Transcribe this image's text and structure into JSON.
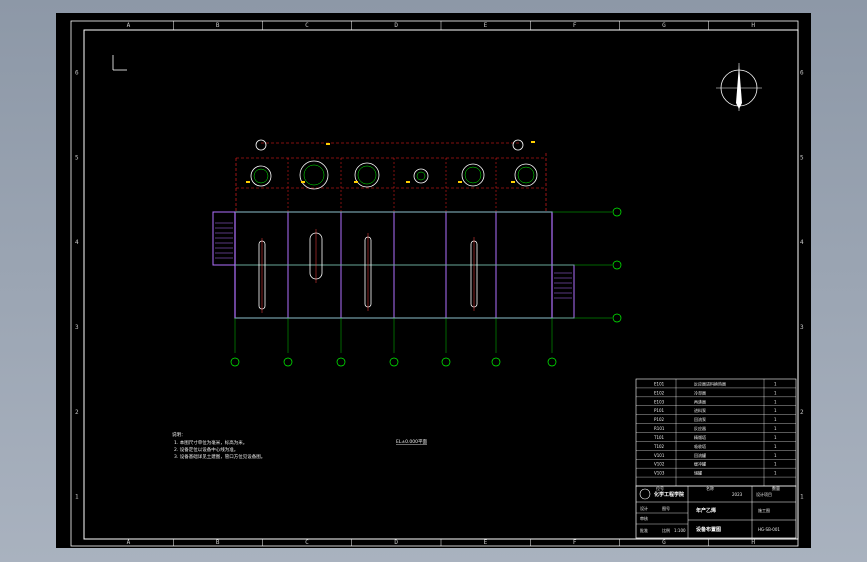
{
  "columns": [
    "A",
    "B",
    "C",
    "D",
    "E",
    "F",
    "G",
    "H"
  ],
  "rows": [
    "6",
    "5",
    "4",
    "3",
    "2",
    "1"
  ],
  "plan_title": "EL±0.000平面",
  "notes": {
    "heading": "说明：",
    "lines": [
      "1. 本图尺寸单位为毫米，标高为米。",
      "2. 设备定位以设备中心线为准。",
      "3. 设备基础详见土建图，管口方位见设备图。"
    ]
  },
  "equipment_list": [
    {
      "tag": "E101",
      "name": "反应器进料换热器",
      "qty": "1"
    },
    {
      "tag": "E102",
      "name": "冷却器",
      "qty": "1"
    },
    {
      "tag": "E103",
      "name": "再沸器",
      "qty": "1"
    },
    {
      "tag": "P101",
      "name": "进料泵",
      "qty": "1"
    },
    {
      "tag": "P102",
      "name": "回流泵",
      "qty": "1"
    },
    {
      "tag": "R101",
      "name": "反应器",
      "qty": "1"
    },
    {
      "tag": "T101",
      "name": "精馏塔",
      "qty": "1"
    },
    {
      "tag": "T102",
      "name": "吸收塔",
      "qty": "1"
    },
    {
      "tag": "V101",
      "name": "回流罐",
      "qty": "1"
    },
    {
      "tag": "V102",
      "name": "缓冲罐",
      "qty": "1"
    },
    {
      "tag": "V103",
      "name": "储罐",
      "qty": "1"
    }
  ],
  "equipment_header": {
    "tag": "位号",
    "name": "名称",
    "qty": "数量"
  },
  "title_block": {
    "org": "化学工程学院",
    "project_label": "设计项目",
    "project": "年产乙烯",
    "drawing_name": "设备布置图",
    "scale_label": "比例",
    "scale": "1:100",
    "sheet_label": "图号",
    "sheet": "HG-SB-001",
    "design_label": "设计",
    "check_label": "审核",
    "approve_label": "批准",
    "stage": "施工图",
    "date": "2023"
  }
}
